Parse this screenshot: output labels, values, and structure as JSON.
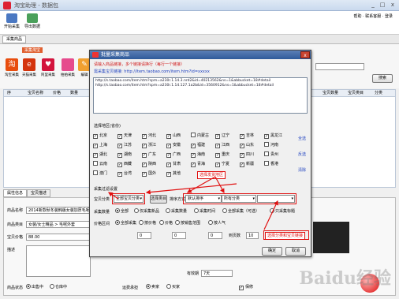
{
  "window": {
    "title": "淘宝助理 - 数据包",
    "minimize": "_",
    "restore": "□",
    "close": "x"
  },
  "topbar": {
    "buttons": [
      {
        "label": "开始采集"
      },
      {
        "label": "导出数据"
      }
    ],
    "links": "帮助 · 联系客服 · 登录"
  },
  "tabs": {
    "active": "采集商品"
  },
  "toolbar": {
    "section_label": "采集淘宝",
    "tools": [
      {
        "label": "淘宝采集",
        "glyph": "淘",
        "color": "#e84e0f"
      },
      {
        "label": "天猫采集",
        "glyph": "e",
        "color": "#d4340d"
      },
      {
        "label": "阿里采集",
        "glyph": "♥",
        "color": "#d3143d"
      },
      {
        "label": "拍拍采集",
        "glyph": "",
        "color": "#e64b8d"
      },
      {
        "label": "编辑",
        "glyph": "✎",
        "color": "#f0a030"
      }
    ],
    "search_button": "搜索"
  },
  "grid": {
    "columns": [
      "序",
      "宝贝名称",
      "价格",
      "数量",
      "状态",
      "宝贝链接",
      "分类",
      "所在地区"
    ],
    "right_columns": [
      "宝贝数量",
      "宝贝类目",
      "分类"
    ]
  },
  "dialog": {
    "title": "批量采集商品",
    "close": "x",
    "hint1": "请输入商品链接，多个链接请换行（每行一个链接）",
    "hint2": "需采集宝贝链接: http://item.taobao.com/item.htm?id=xxxxx",
    "urls": [
      "http://s.taobao.com/item.htm?spm=a230r.1.14.3.nrd2&id=40213562&ns=1&abbucket=18#detail",
      "http://s.taobao.com/item.htm?spm=a230r.1.14.127.1a2b&id=3560912&ns=1&abbucket=18#detail"
    ],
    "region_label": "选择地区(省份)",
    "provinces": [
      [
        "北京",
        "天津",
        "河北",
        "山西",
        "内蒙古",
        "辽宁",
        "吉林",
        "黑龙江"
      ],
      [
        "上海",
        "江苏",
        "浙江",
        "安徽",
        "福建",
        "江西",
        "山东",
        "河南"
      ],
      [
        "湖北",
        "湖南",
        "广东",
        "广西",
        "海南",
        "重庆",
        "四川",
        "贵州"
      ],
      [
        "云南",
        "西藏",
        "陕西",
        "甘肃",
        "青海",
        "宁夏",
        "新疆",
        "香港"
      ],
      [
        "澳门",
        "台湾",
        "国外",
        "其他"
      ]
    ],
    "side_links": [
      "全选",
      "反选",
      "清除"
    ],
    "filter_section": "采集过滤设置",
    "filter": {
      "cat_label": "宝贝分类",
      "cat_value": "全部宝贝分类",
      "sub_btn": "选择类目",
      "order_label": "排序方式",
      "order_value": "默认排序",
      "sel3_value": "所有分类",
      "sel4_value": ""
    },
    "callout_top": "选择发货地区",
    "callout_right": "选择分类和宝贝链接",
    "opt_label": "采集数量",
    "radios1": [
      "全部",
      "仅采集新品",
      "采集数量",
      "采集时间",
      "全部采集（可选）",
      "只采集标题"
    ],
    "range_label": "价格区间",
    "radios2": [
      "全部采集",
      "按价格",
      "价格",
      "按销售范围",
      "按人气"
    ],
    "range_inputs": [
      "0",
      "0",
      "0"
    ],
    "num_label": "页数",
    "num_value": "10",
    "page_label": "到页数",
    "ok": "确定",
    "cancel": "取消"
  },
  "bottom": {
    "tabs": [
      "属性信息",
      "宝贝描述"
    ],
    "fields": [
      {
        "label": "商品名称",
        "value": "2014新款秋冬装韩版女装加厚毛呢外套"
      },
      {
        "label": "商品类目",
        "value": "女装/女士精品 > 毛呢外套"
      },
      {
        "label": "宝贝价格",
        "value": "88.00"
      },
      {
        "label": "描述",
        "value": ""
      }
    ],
    "stock_label": "宝贝数量",
    "stock_value": "300",
    "status_label": "商品状态",
    "status_radios": [
      "出售中",
      "仓库中"
    ],
    "right_label": "发布时间",
    "ship_label": "运费承担",
    "ship_radios": [
      "卖家",
      "买家"
    ],
    "warranty": "保修",
    "time_label": "有效期",
    "time_value": "7天"
  },
  "watermark": "Baidu经验"
}
